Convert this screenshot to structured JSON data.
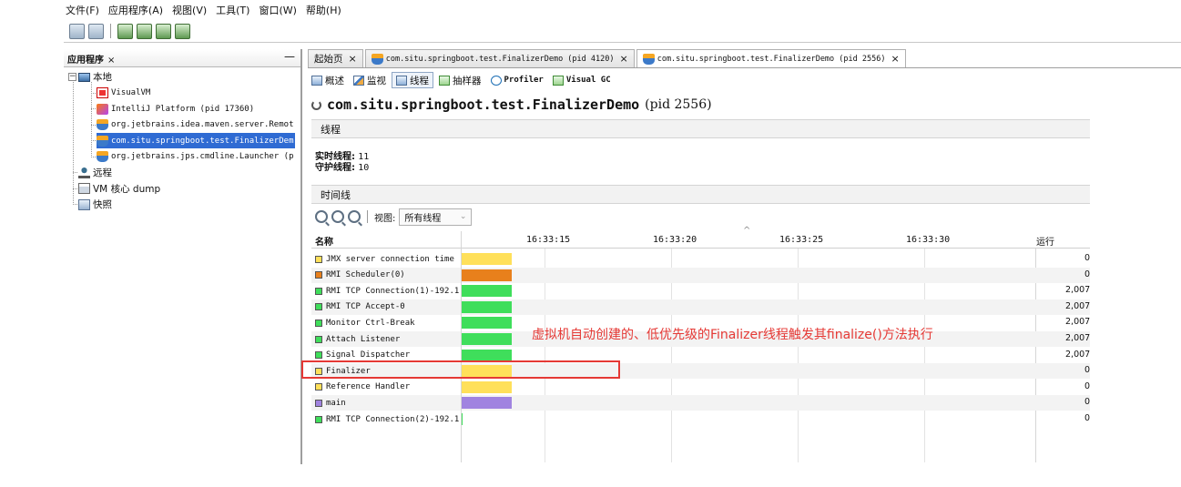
{
  "menu": [
    "文件(F)",
    "应用程序(A)",
    "视图(V)",
    "工具(T)",
    "窗口(W)",
    "帮助(H)"
  ],
  "left_panel": {
    "tab_label": "应用程序",
    "tab_close": "×",
    "minimize": "—",
    "tree": [
      {
        "label": "本地",
        "level": 0,
        "icon": "monitor-icon"
      },
      {
        "label": "VisualVM",
        "level": 1,
        "icon": "visualvm-icon"
      },
      {
        "label": "IntelliJ Platform (pid 17360)",
        "level": 1,
        "icon": "intellij-icon"
      },
      {
        "label": "org.jetbrains.idea.maven.server.Remot",
        "level": 1,
        "icon": "java-icon"
      },
      {
        "label": "com.situ.springboot.test.FinalizerDem",
        "level": 1,
        "icon": "java-icon",
        "selected": true
      },
      {
        "label": "org.jetbrains.jps.cmdline.Launcher (p",
        "level": 1,
        "icon": "java-icon"
      },
      {
        "label": "远程",
        "level": 0,
        "icon": "remote-icon"
      },
      {
        "label": "VM 核心 dump",
        "level": 0,
        "icon": "core-dump-icon"
      },
      {
        "label": "快照",
        "level": 0,
        "icon": "snapshot-icon"
      }
    ]
  },
  "doc_tabs": [
    {
      "label": "起始页",
      "close": "×"
    },
    {
      "label": "com.situ.springboot.test.FinalizerDemo (pid 4120)",
      "close": "×"
    },
    {
      "label": "com.situ.springboot.test.FinalizerDemo (pid 2556)",
      "close": "×",
      "active": true
    }
  ],
  "sub_tabs": [
    {
      "label": "概述",
      "icon": "overview-icon"
    },
    {
      "label": "监视",
      "icon": "monitor-chart-icon"
    },
    {
      "label": "线程",
      "icon": "threads-icon",
      "active": true
    },
    {
      "label": "抽样器",
      "icon": "sampler-icon"
    },
    {
      "label": "Profiler",
      "icon": "profiler-icon"
    },
    {
      "label": "Visual GC",
      "icon": "visual-gc-icon"
    }
  ],
  "process": {
    "name": "com.situ.springboot.test.FinalizerDemo",
    "pid": "(pid 2556)"
  },
  "threads_section": {
    "header": "线程",
    "live_label": "实时线程:",
    "live_value": "11",
    "daemon_label": "守护线程:",
    "daemon_value": "10"
  },
  "timeline": {
    "header": "时间线",
    "view_label": "视图:",
    "view_value": "所有线程",
    "col_name": "名称",
    "col_run": "运行",
    "ticks": [
      "16:33:15",
      "16:33:20",
      "16:33:25",
      "16:33:30"
    ],
    "rows": [
      {
        "name": "JMX server connection time",
        "state_color": "#ffe05a",
        "bar_width": 56,
        "run": "0"
      },
      {
        "name": "RMI Scheduler(0)",
        "state_color": "#e8801c",
        "bar_width": 56,
        "run": "0"
      },
      {
        "name": "RMI TCP Connection(1)-192.1",
        "state_color": "#3fde5b",
        "bar_width": 56,
        "run": "2,007"
      },
      {
        "name": "RMI TCP Accept-0",
        "state_color": "#3fde5b",
        "bar_width": 56,
        "run": "2,007"
      },
      {
        "name": "Monitor Ctrl-Break",
        "state_color": "#3fde5b",
        "bar_width": 56,
        "run": "2,007"
      },
      {
        "name": "Attach Listener",
        "state_color": "#3fde5b",
        "bar_width": 56,
        "run": "2,007"
      },
      {
        "name": "Signal Dispatcher",
        "state_color": "#3fde5b",
        "bar_width": 56,
        "run": "2,007"
      },
      {
        "name": "Finalizer",
        "state_color": "#ffe05a",
        "bar_width": 56,
        "run": "0"
      },
      {
        "name": "Reference Handler",
        "state_color": "#ffe05a",
        "bar_width": 56,
        "run": "0"
      },
      {
        "name": "main",
        "state_color": "#a083e0",
        "bar_width": 56,
        "run": "0"
      },
      {
        "name": "RMI TCP Connection(2)-192.1",
        "state_color": "#3fde5b",
        "bar_width": 2,
        "run": "0"
      }
    ]
  },
  "annotation": "虚拟机自动创建的、低优先级的Finalizer线程触发其finalize()方法执行"
}
